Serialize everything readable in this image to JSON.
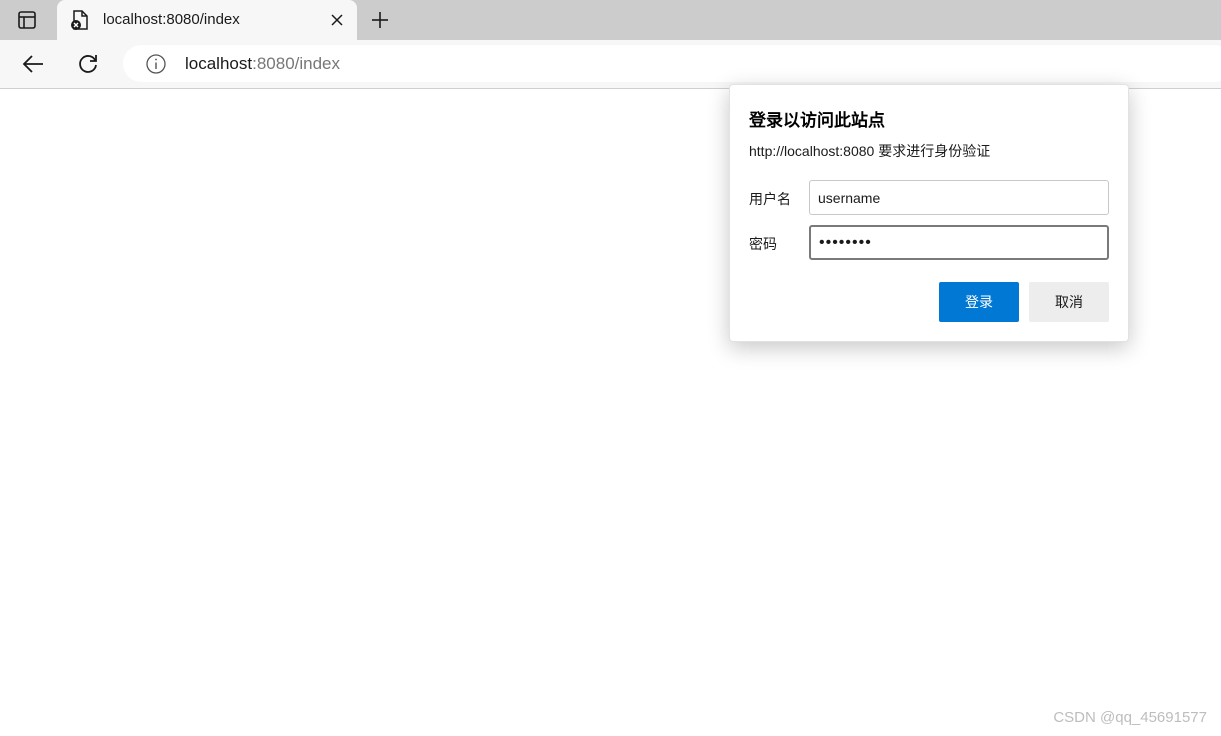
{
  "browser": {
    "tab": {
      "title": "localhost:8080/index",
      "favicon_icon": "page-error-icon",
      "close_icon": "close-icon"
    },
    "tab_actions_icon": "tab-actions-icon",
    "new_tab_icon": "plus-icon",
    "back_icon": "arrow-left-icon",
    "reload_icon": "reload-icon",
    "address": {
      "info_icon": "info-icon",
      "host": "localhost",
      "rest": ":8080/index"
    }
  },
  "auth_dialog": {
    "title": "登录以访问此站点",
    "message": "http://localhost:8080 要求进行身份验证",
    "username_label": "用户名",
    "username_value": "username",
    "password_label": "密码",
    "password_value": "••••••••",
    "login_label": "登录",
    "cancel_label": "取消"
  },
  "watermark": "CSDN @qq_45691577",
  "colors": {
    "primary_button": "#0078d4",
    "tabbar": "#cccccc",
    "toolbar": "#f7f7f7"
  }
}
